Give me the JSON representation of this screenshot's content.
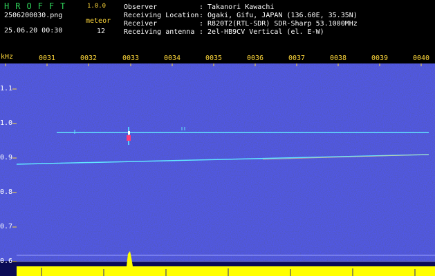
{
  "app": {
    "name": "HROFFT",
    "version": "1.0.0"
  },
  "file": {
    "name": "2506200030.png",
    "datetime": "25.06.20 00:30"
  },
  "meteor": {
    "label": "meteor",
    "count": "12"
  },
  "info": [
    {
      "key": "Observer",
      "value": ": Takanori Kawachi"
    },
    {
      "key": "Receiving Location",
      "value": ": Ogaki, Gifu, JAPAN (136.60E, 35.35N)"
    },
    {
      "key": "Receiver",
      "value": ": R820T2(RTL-SDR) SDR-Sharp 53.1000MHz"
    },
    {
      "key": "Receiving antenna",
      "value": ": 2el-HB9CV Vertical (el. E-W)"
    }
  ],
  "axis": {
    "unit": "kHz",
    "time_ticks": [
      "0031",
      "0032",
      "0033",
      "0034",
      "0035",
      "0036",
      "0037",
      "0038",
      "0039",
      "0040"
    ],
    "freq_ticks": [
      "1.1",
      "1.0",
      "0.9",
      "0.8",
      "0.7",
      "0.6"
    ]
  },
  "colors": {
    "header_text": "#ffffff",
    "accent": "#ffd83a",
    "app_name": "#2fd35a",
    "background": "#000000",
    "noise": "#10106a",
    "trace": "#62e6ff",
    "level_bar": "#ffff00"
  }
}
